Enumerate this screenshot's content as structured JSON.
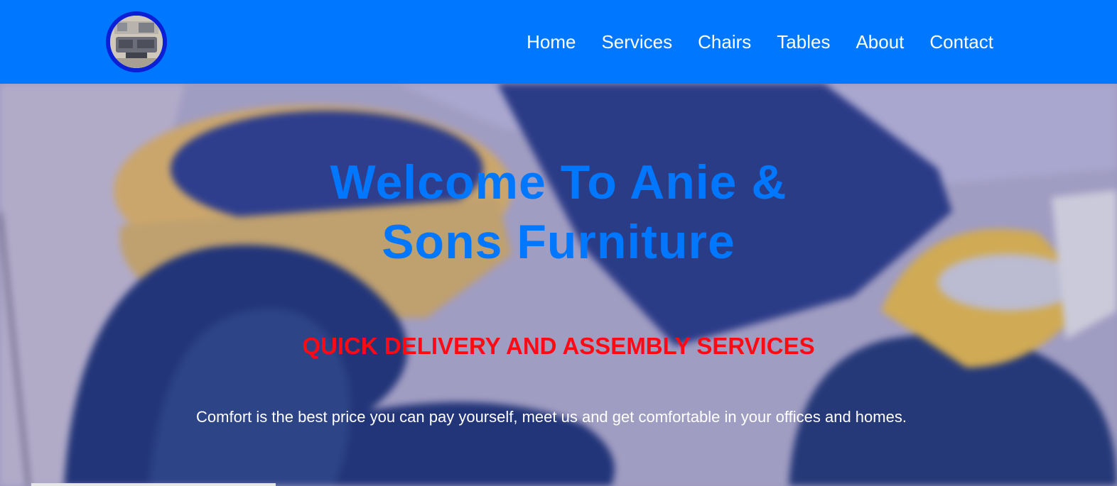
{
  "nav": {
    "items": [
      {
        "label": "Home"
      },
      {
        "label": "Services"
      },
      {
        "label": "Chairs"
      },
      {
        "label": "Tables"
      },
      {
        "label": "About"
      },
      {
        "label": "Contact"
      }
    ]
  },
  "hero": {
    "title_line1": "Welcome To Anie &",
    "title_line2": "Sons Furniture",
    "subtitle": "QUICK DELIVERY AND ASSEMBLY SERVICES",
    "tagline": "Comfort is the best price you can pay yourself, meet us and get comfortable in your offices and homes."
  },
  "colors": {
    "brand": "#0077ff",
    "logo_ring": "#0a1fd6",
    "subtitle": "#ff0a14",
    "tagline": "#ffffff"
  }
}
